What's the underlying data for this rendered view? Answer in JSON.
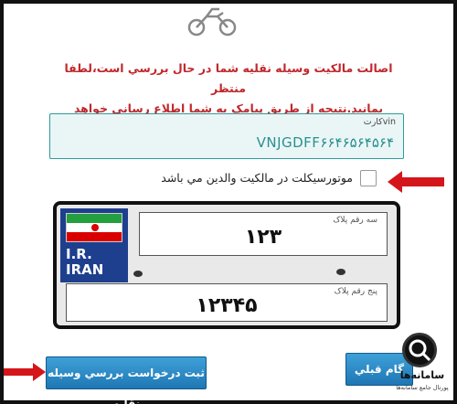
{
  "icons": {
    "motorcycle": "motorcycle-icon",
    "arrow": "red-arrow-icon",
    "logo": "samaneha-logo"
  },
  "colors": {
    "message": "#c0282d",
    "accent": "#2d9b9b",
    "button": "#1f77b4",
    "arrow": "#d4161a",
    "plate_panel": "#1e3f8d"
  },
  "message": {
    "line1": "اصالت مالکيت وسيله نقليه شما در حال بررسي است،لطفا منتظر",
    "line2": "بمانيد.نتيجه از طريق پيامک به شما اطلاع رساني خواهد شد ."
  },
  "vin": {
    "label": "vinکارت",
    "value": "VNJGDFF۶۶۴۶۵۶۴۵۶۴"
  },
  "parents_ownership": {
    "label": "موتورسيکلت در مالکيت والدين مي باشد",
    "checked": false
  },
  "plate": {
    "country_line1": "I.R.",
    "country_line2": "IRAN",
    "three_digit_label": "سه رقم پلاک",
    "three_digit_value": "۱۲۳",
    "five_digit_label": "پنج رقم پلاک",
    "five_digit_value": "۱۲۳۴۵"
  },
  "buttons": {
    "submit": "ثبت درخواست بررسي وسيله نقليه",
    "previous": "گام قبلي"
  },
  "branding": {
    "name": "سامانه‌ها",
    "tagline": "پورتال جامع سامانه‌ها"
  }
}
